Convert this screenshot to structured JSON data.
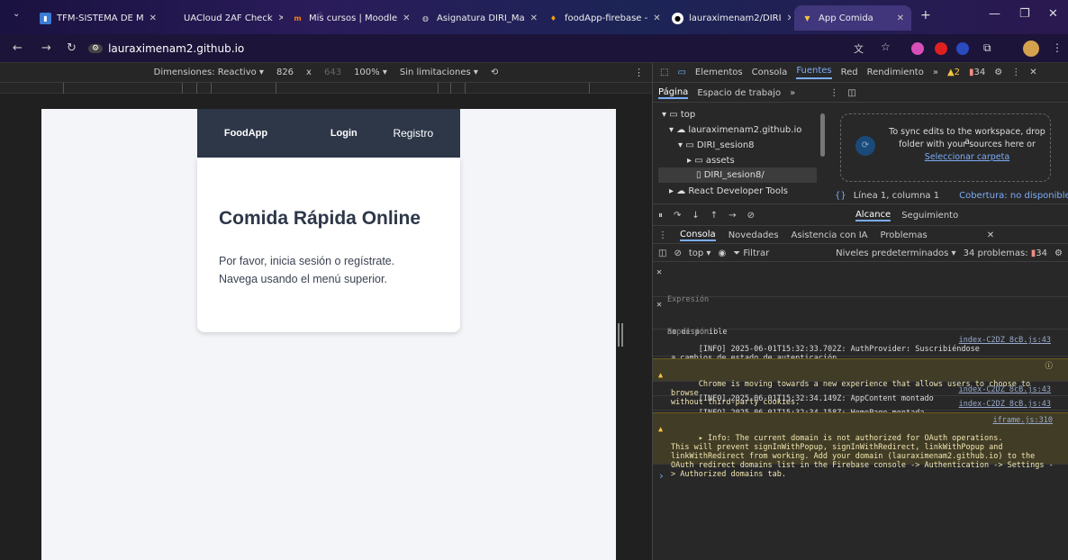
{
  "tabs": [
    {
      "label": "TFM-SISTEMA DE M",
      "icon": "bookmark-icon",
      "active": false
    },
    {
      "label": "UACloud 2AF Check",
      "icon": "none",
      "active": false
    },
    {
      "label": "Mis cursos | Moodle",
      "icon": "moodle-icon",
      "active": false
    },
    {
      "label": "Asignatura DIRI_Ma",
      "icon": "globe-icon",
      "active": false
    },
    {
      "label": "foodApp-firebase -",
      "icon": "firebase-icon",
      "active": false
    },
    {
      "label": "lauraximenam2/DIRI",
      "icon": "github-icon",
      "active": false
    },
    {
      "label": "App Comida",
      "icon": "react-icon",
      "active": true
    }
  ],
  "address": {
    "url": "lauraximenam2.github.io"
  },
  "device_bar": {
    "dimensions": "Dimensiones: Reactivo ▾",
    "width": "826",
    "x": "x",
    "height": "643",
    "zoom": "100% ▾",
    "throttle": "Sin limitaciones ▾"
  },
  "app": {
    "brand": "FoodApp",
    "login": "Login",
    "register": "Registro",
    "title": "Comida Rápida Online",
    "line1": "Por favor, inicia sesión o regístrate.",
    "line2": "Navega usando el menú superior."
  },
  "devtools": {
    "tabs": [
      "Elementos",
      "Consola",
      "Fuentes",
      "Red",
      "Rendimiento",
      "»"
    ],
    "selected_tab": "Fuentes",
    "warnings": "2",
    "errors": "34",
    "sources_tabs": {
      "page": "Página",
      "workspace": "Espacio de trabajo",
      "more": "»"
    },
    "tree": {
      "top": "top",
      "domain": "lauraximenam2.github.io",
      "folder": "DIRI_sesion8",
      "assets": "assets",
      "file": "DIRI_sesion8/",
      "react": "React Developer Tools"
    },
    "sync": {
      "line1": "To sync edits to the workspace, drop a",
      "line2": "folder with your sources here or",
      "link": "Seleccionar carpeta"
    },
    "position": "Línea 1, columna 1",
    "coverage": "Cobertura: no disponible",
    "scope_tabs": {
      "scope": "Alcance",
      "watch": "Seguimiento"
    },
    "drawer_tabs": [
      "Consola",
      "Novedades",
      "Asistencia con IA",
      "Problemas"
    ],
    "console_toolbar": {
      "context": "top ▾",
      "filter": "Filtrar",
      "levels": "Niveles predeterminados ▾",
      "problems": "34 problemas:",
      "problem_count": "34"
    },
    "expressions": [
      {
        "label": "Expresión",
        "value": "no disponible"
      },
      {
        "label": "Expresión",
        "value": "no disponible"
      }
    ],
    "messages": [
      {
        "type": "info",
        "text": "[INFO] 2025-06-01T15:32:33.702Z: AuthProvider: Suscribiéndose\na cambios de estado de autenticación.",
        "source": "index-C2DZ_8cB.js:43"
      },
      {
        "type": "warn",
        "text": "Chrome is moving towards a new experience that allows users to choose to browse\nwithout third-party cookies.",
        "source": ""
      },
      {
        "type": "info",
        "text": "[INFO] 2025-06-01T15:32:34.149Z: AppContent montado",
        "source": "index-C2DZ_8cB.js:43"
      },
      {
        "type": "info",
        "text": "[INFO] 2025-06-01T15:32:34.158Z: HomePage montada",
        "source": "index-C2DZ_8cB.js:43"
      },
      {
        "type": "warn",
        "text": "▸ Info: The current domain is not authorized for OAuth operations.\nThis will prevent signInWithPopup, signInWithRedirect, linkWithPopup and\nlinkWithRedirect from working. Add your domain (lauraximenam2.github.io) to the\nOAuth redirect domains list in the Firebase console -> Authentication -> Settings -\n> Authorized domains tab.",
        "source": "iframe.js:310"
      }
    ],
    "prompt": "›"
  }
}
